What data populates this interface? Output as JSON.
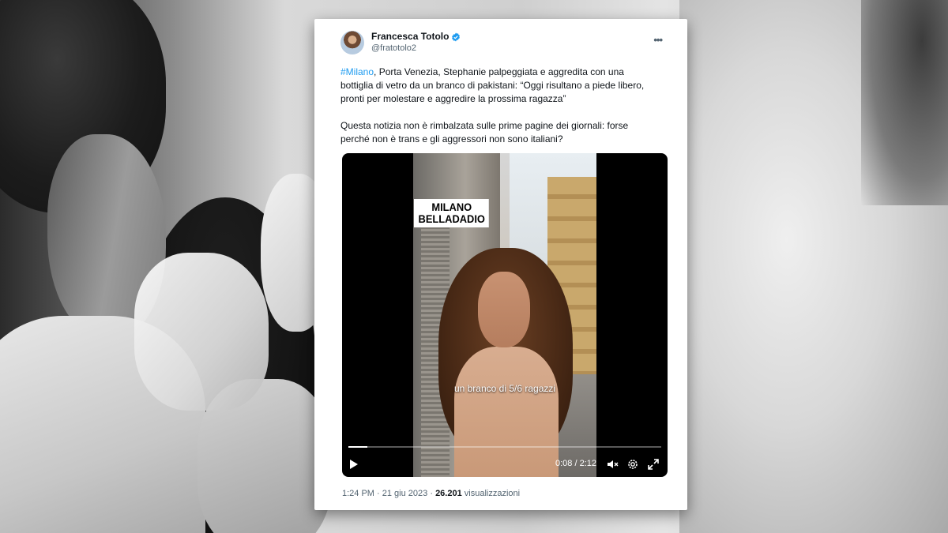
{
  "tweet": {
    "author_name": "Francesca Totolo",
    "author_handle": "@fratotolo2",
    "hashtag": "#Milano",
    "paragraph1_rest": ", Porta Venezia, Stephanie palpeggiata e aggredita con una bottiglia di vetro da un branco di pakistani: “Oggi risultano a piede libero, pronti per molestare e aggredire la prossima ragazza”",
    "paragraph2": "Questa notizia non è rimbalzata sulle prime pagine dei giornali: forse perché non è trans e gli aggressori non sono italiani?",
    "time": "1:24 PM",
    "date": "21 giu 2023",
    "views_count": "26.201",
    "views_label": "visualizzazioni",
    "separator": "·"
  },
  "video": {
    "label_line1": "MILANO",
    "label_line2": "BELLADADIO",
    "subtitle": "un branco di 5/6 ragazzi",
    "time_display": "0:08 / 2:12",
    "progress_fraction": 0.06
  },
  "icons": {
    "verified": "verified-badge-icon",
    "more": "more-options-icon",
    "play": "play-icon",
    "volume": "volume-icon",
    "settings": "settings-icon",
    "fullscreen": "fullscreen-icon"
  },
  "colors": {
    "link": "#1d9bf0",
    "text": "#0f1419",
    "secondary": "#536471"
  }
}
